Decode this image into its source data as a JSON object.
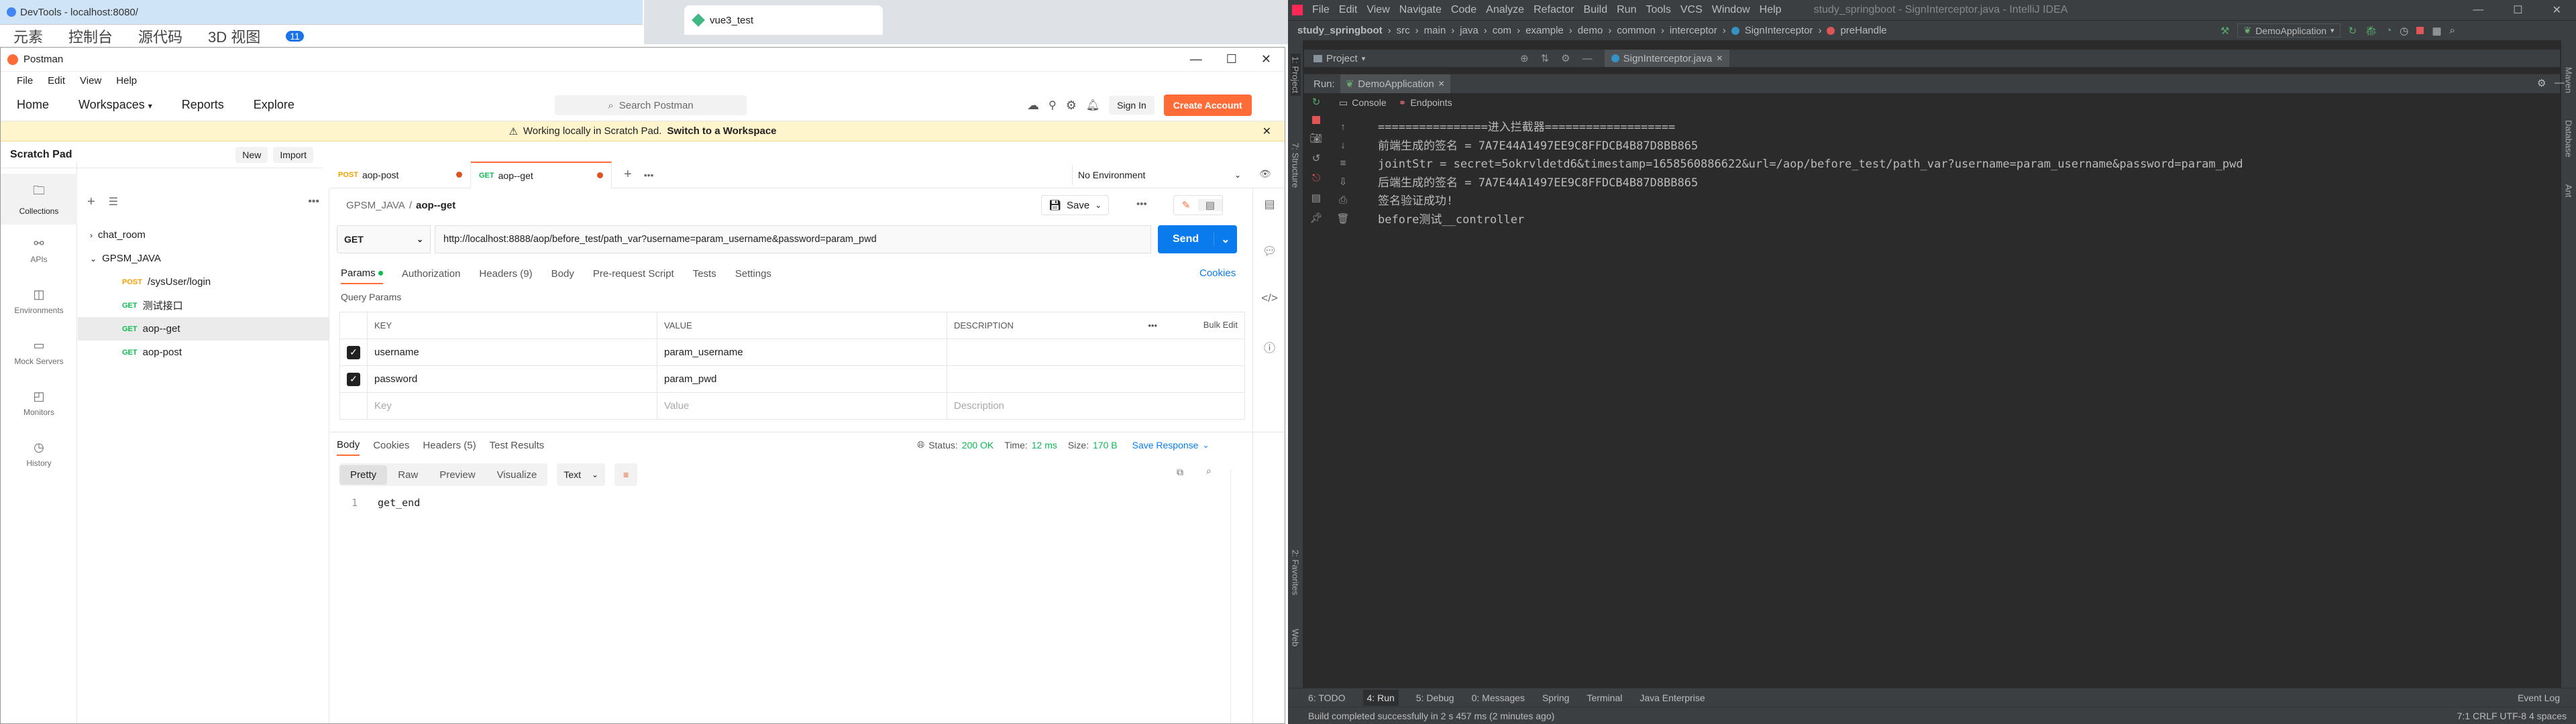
{
  "bg_window_1": {
    "title": "DevTools - localhost:8080/",
    "tabs": [
      "元素",
      "控制台",
      "源代码",
      "3D 视图"
    ],
    "badge": "11"
  },
  "bg_window_2": {
    "tab_title": "vue3_test"
  },
  "postman": {
    "window_title": "Postman",
    "menu": [
      "File",
      "Edit",
      "View",
      "Help"
    ],
    "nav": [
      "Home",
      "Workspaces",
      "Reports",
      "Explore"
    ],
    "search_placeholder": "Search Postman",
    "sign_in": "Sign In",
    "create_account": "Create Account",
    "banner_text": "Working locally in Scratch Pad.",
    "banner_link": "Switch to a Workspace",
    "scratch_pad": "Scratch Pad",
    "new_label": "New",
    "import_label": "Import",
    "sidebar": [
      "Collections",
      "APIs",
      "Environments",
      "Mock Servers",
      "Monitors",
      "History"
    ],
    "tree": {
      "chat_room": "chat_room",
      "gpsm_java": "GPSM_JAVA",
      "items": [
        {
          "method": "POST",
          "name": "/sysUser/login"
        },
        {
          "method": "GET",
          "name": "测试接口"
        },
        {
          "method": "GET",
          "name": "aop--get"
        },
        {
          "method": "GET",
          "name": "aop-post"
        }
      ]
    },
    "req_tabs": [
      {
        "method": "POST",
        "name": "aop-post"
      },
      {
        "method": "GET",
        "name": "aop--get"
      }
    ],
    "environment": "No Environment",
    "breadcrumb_parent": "GPSM_JAVA",
    "breadcrumb_current": "aop--get",
    "save_label": "Save",
    "method": "GET",
    "url": "http://localhost:8888/aop/before_test/path_var?username=param_username&password=param_pwd",
    "send_label": "Send",
    "request_tabs": [
      "Params",
      "Authorization",
      "Headers (9)",
      "Body",
      "Pre-request Script",
      "Tests",
      "Settings"
    ],
    "cookies_label": "Cookies",
    "query_params_label": "Query Params",
    "col_key": "KEY",
    "col_value": "VALUE",
    "col_description": "DESCRIPTION",
    "bulk_edit": "Bulk Edit",
    "params": [
      {
        "key": "username",
        "value": "param_username"
      },
      {
        "key": "password",
        "value": "param_pwd"
      }
    ],
    "key_placeholder": "Key",
    "value_placeholder": "Value",
    "desc_placeholder": "Description",
    "response_tabs": [
      "Body",
      "Cookies",
      "Headers (5)",
      "Test Results"
    ],
    "status_label": "Status:",
    "status_value": "200 OK",
    "time_label": "Time:",
    "time_value": "12 ms",
    "size_label": "Size:",
    "size_value": "170 B",
    "save_response": "Save Response",
    "view_modes": [
      "Pretty",
      "Raw",
      "Preview",
      "Visualize"
    ],
    "format": "Text",
    "line_no": "1",
    "response_body": "get_end"
  },
  "intellij": {
    "menu": [
      "File",
      "Edit",
      "View",
      "Navigate",
      "Code",
      "Analyze",
      "Refactor",
      "Build",
      "Run",
      "Tools",
      "VCS",
      "Window",
      "Help"
    ],
    "title": "study_springboot - SignInterceptor.java - IntelliJ IDEA",
    "breadcrumbs": [
      "study_springboot",
      "src",
      "main",
      "java",
      "com",
      "example",
      "demo",
      "common",
      "interceptor",
      "SignInterceptor",
      "preHandle"
    ],
    "run_config": "DemoApplication",
    "project_label": "Project",
    "editor_tab": "SignInterceptor.java",
    "run_label": "Run:",
    "run_tab": "DemoApplication",
    "console_tab": "Console",
    "endpoints_tab": "Endpoints",
    "console_lines": [
      "================进入拦截器===================",
      "前端生成的签名 = 7A7E44A1497EE9C8FFDCB4B87D8BB865",
      "jointStr = secret=5okrvldetd6&timestamp=1658560886622&url=/aop/before_test/path_var?username=param_username&password=param_pwd",
      "后端生成的签名 = 7A7E44A1497EE9C8FFDCB4B87D8BB865",
      "签名验证成功!",
      "before测试__controller"
    ],
    "left_tools": [
      "1: Project",
      "7: Structure",
      "2: Favorites",
      "Web"
    ],
    "right_tools": [
      "Maven",
      "Database",
      "Ant"
    ],
    "bottom_tools": [
      "6: TODO",
      "4: Run",
      "5: Debug",
      "0: Messages",
      "Spring",
      "Terminal",
      "Java Enterprise"
    ],
    "event_log": "Event Log",
    "status_text": "Build completed successfully in 2 s 457 ms (2 minutes ago)",
    "status_right": "7:1  CRLF  UTF-8  4 spaces"
  }
}
